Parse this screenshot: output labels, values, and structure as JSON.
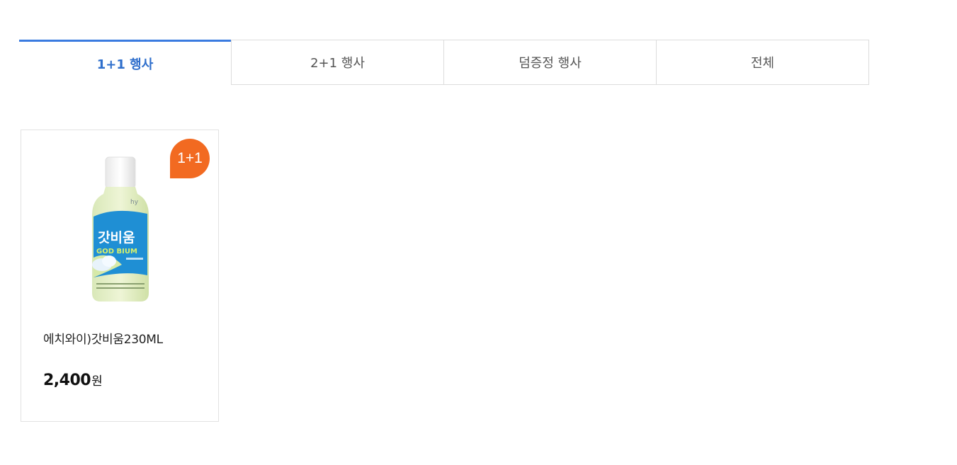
{
  "tabs": [
    {
      "label": "1+1 행사",
      "active": true
    },
    {
      "label": "2+1 행사",
      "active": false
    },
    {
      "label": "덤증정 행사",
      "active": false
    },
    {
      "label": "전체",
      "active": false
    }
  ],
  "colors": {
    "accent": "#3a7be0",
    "badge": "#f26a21"
  },
  "product": {
    "badge": "1+1",
    "name": "에치와이)갓비움230ML",
    "price_value": "2,400",
    "price_unit": "원",
    "image_icon": "drink-bottle-image",
    "label_text": {
      "brand": "hy",
      "title": "갓비움",
      "subtitle": "GOD BIUM"
    }
  }
}
